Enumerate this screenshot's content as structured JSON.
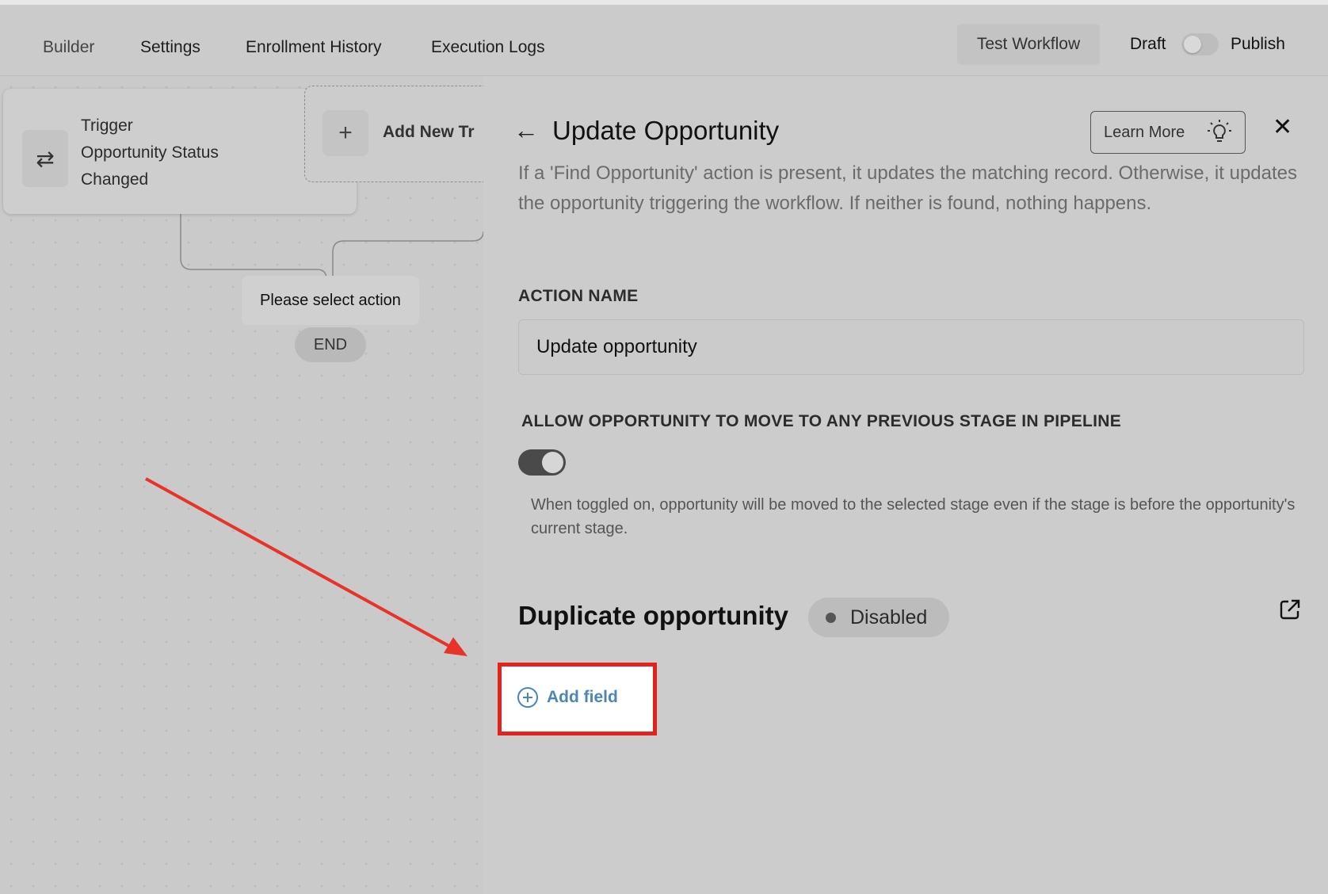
{
  "tabs": [
    {
      "label": "Builder",
      "active": true
    },
    {
      "label": "Settings",
      "active": false
    },
    {
      "label": "Enrollment History",
      "active": false
    },
    {
      "label": "Execution Logs",
      "active": false
    }
  ],
  "header": {
    "test_button": "Test Workflow",
    "draft_label": "Draft",
    "publish_label": "Publish",
    "publish_toggle_on": false
  },
  "canvas": {
    "trigger": {
      "line1": "Trigger",
      "line2": "Opportunity Status",
      "line3": "Changed",
      "icon": "swap-arrows-icon"
    },
    "add_new_trigger": "Add New Tr",
    "select_action": "Please select action",
    "end_label": "END"
  },
  "panel": {
    "title": "Update Opportunity",
    "learn_more": "Learn More",
    "description": "If a 'Find Opportunity' action is present, it updates the matching record. Otherwise, it updates the opportunity triggering the workflow. If neither is found, nothing happens.",
    "action_name_label": "ACTION NAME",
    "action_name_value": "Update opportunity",
    "allow_label": "ALLOW OPPORTUNITY TO MOVE TO ANY PREVIOUS STAGE IN PIPELINE",
    "allow_toggle_on": true,
    "allow_help": "When toggled on, opportunity will be moved to the selected stage even if the stage is before the opportunity's current stage.",
    "duplicate_title": "Duplicate opportunity",
    "duplicate_status": "Disabled",
    "add_field": "Add field"
  },
  "colors": {
    "highlight": "#e3231b",
    "annotation_arrow": "#e8332a",
    "link": "#4a86b8"
  }
}
